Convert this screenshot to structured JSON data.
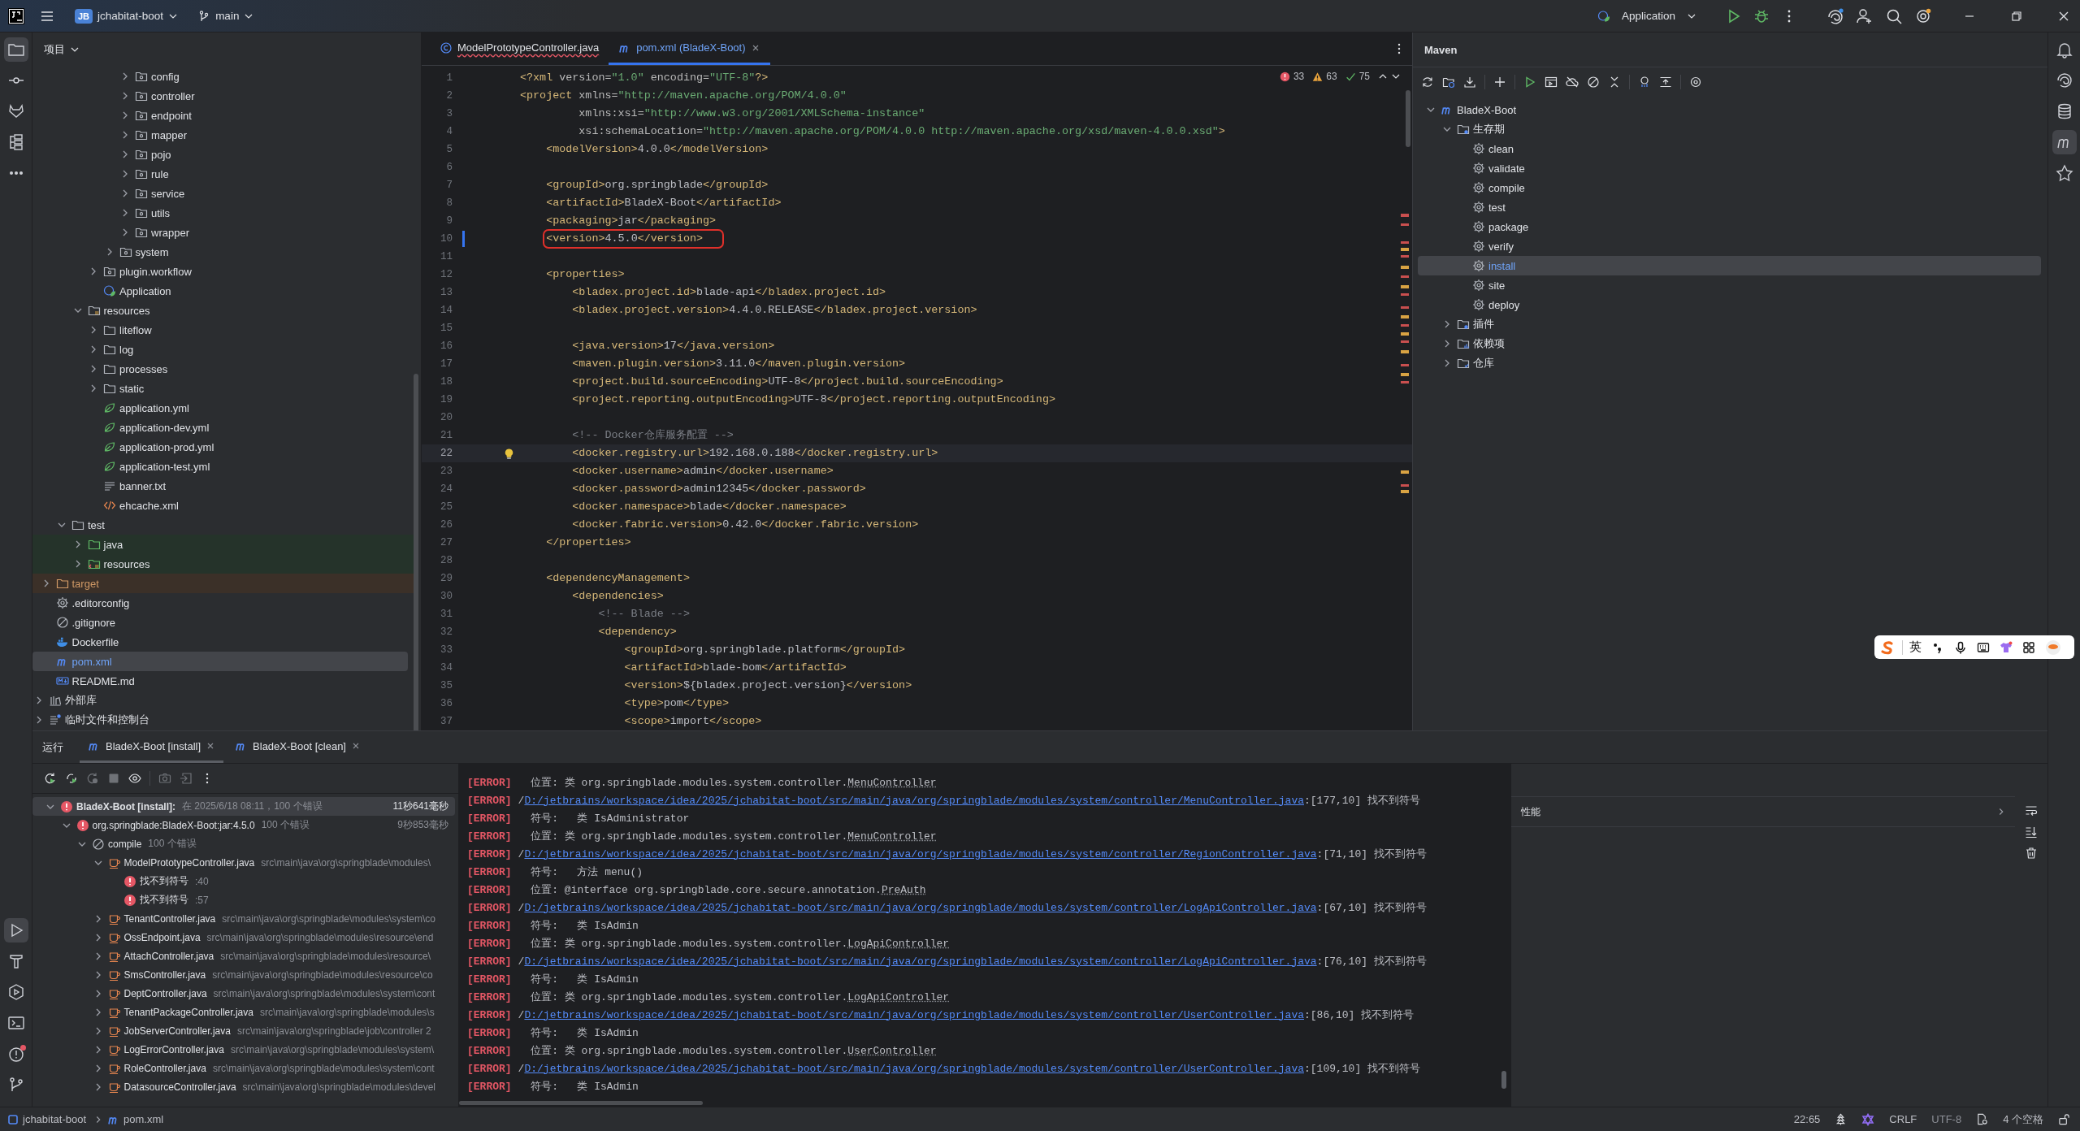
{
  "title_bar": {
    "project_badge": "JB",
    "project": "jchabitat-boot",
    "branch": "main",
    "run_config": "Application"
  },
  "left_toolbar": {
    "top": [
      {
        "kind": "project",
        "selected": true
      },
      {
        "kind": "commit",
        "selected": false
      },
      {
        "kind": "cat",
        "selected": false
      },
      {
        "kind": "structure",
        "selected": false
      },
      {
        "kind": "more",
        "selected": false
      }
    ],
    "bottom": [
      {
        "kind": "run",
        "selected": true
      },
      {
        "kind": "build",
        "selected": false
      },
      {
        "kind": "services",
        "selected": false
      },
      {
        "kind": "terminal",
        "selected": false
      },
      {
        "kind": "problems",
        "selected": false,
        "badge": true
      },
      {
        "kind": "git",
        "selected": false
      }
    ]
  },
  "right_toolbar": [
    {
      "kind": "notifications",
      "selected": false
    },
    {
      "kind": "spiral",
      "selected": false
    },
    {
      "kind": "database",
      "selected": false
    },
    {
      "kind": "maven",
      "selected": true
    },
    {
      "kind": "star",
      "selected": false
    }
  ],
  "project_panel": {
    "title": "项目",
    "tree": [
      {
        "children": [
          {
            "children": [
              {
                "children": [
                  {
                    "children": [
                      {
                        "children": [
                          {
                            "children": [
                              {
                                "label": "config",
                                "kind": "package",
                                "expanded": false,
                                "selected": false
                              },
                              {
                                "label": "controller",
                                "kind": "package",
                                "expanded": false,
                                "selected": false
                              },
                              {
                                "label": "endpoint",
                                "kind": "package",
                                "expanded": false,
                                "selected": false
                              },
                              {
                                "label": "mapper",
                                "kind": "package",
                                "expanded": false,
                                "selected": false
                              },
                              {
                                "label": "pojo",
                                "kind": "package",
                                "expanded": false,
                                "selected": false
                              },
                              {
                                "label": "rule",
                                "kind": "package",
                                "expanded": false,
                                "selected": false
                              },
                              {
                                "label": "service",
                                "kind": "package",
                                "expanded": false,
                                "selected": false
                              },
                              {
                                "label": "utils",
                                "kind": "package",
                                "expanded": false,
                                "selected": false
                              },
                              {
                                "label": "wrapper",
                                "kind": "package",
                                "expanded": false,
                                "selected": false
                              }
                            ]
                          },
                          {
                            "label": "system",
                            "kind": "package",
                            "expanded": false,
                            "selected": false
                          }
                        ]
                      },
                      {
                        "label": "plugin.workflow",
                        "kind": "package",
                        "expanded": false,
                        "selected": false
                      },
                      {
                        "label": "Application",
                        "kind": "spring-app",
                        "selected": false
                      }
                    ]
                  },
                  {
                    "label": "resources",
                    "kind": "resources",
                    "expanded": true,
                    "selected": false,
                    "children": [
                      {
                        "label": "liteflow",
                        "kind": "folder",
                        "expanded": false,
                        "selected": false
                      },
                      {
                        "label": "log",
                        "kind": "folder",
                        "expanded": false,
                        "selected": false
                      },
                      {
                        "label": "processes",
                        "kind": "folder",
                        "expanded": false,
                        "selected": false
                      },
                      {
                        "label": "static",
                        "kind": "folder",
                        "expanded": false,
                        "selected": false
                      },
                      {
                        "label": "application.yml",
                        "kind": "yml",
                        "selected": false
                      },
                      {
                        "label": "application-dev.yml",
                        "kind": "yml",
                        "selected": false
                      },
                      {
                        "label": "application-prod.yml",
                        "kind": "yml",
                        "selected": false
                      },
                      {
                        "label": "application-test.yml",
                        "kind": "yml",
                        "selected": false
                      },
                      {
                        "label": "banner.txt",
                        "kind": "text",
                        "selected": false
                      },
                      {
                        "label": "ehcache.xml",
                        "kind": "xml",
                        "selected": false
                      }
                    ]
                  }
                ]
              },
              {
                "label": "test",
                "kind": "folder",
                "expanded": true,
                "selected": false,
                "children": [
                  {
                    "label": "java",
                    "kind": "test-sources",
                    "expanded": false,
                    "selected": false
                  },
                  {
                    "label": "resources",
                    "kind": "test-resources",
                    "expanded": false,
                    "selected": false
                  }
                ]
              }
            ]
          },
          {
            "label": "target",
            "kind": "excluded",
            "expanded": false,
            "selected": false
          },
          {
            "label": ".editorconfig",
            "kind": "config",
            "selected": false
          },
          {
            "label": ".gitignore",
            "kind": "ignore",
            "selected": false
          },
          {
            "label": "Dockerfile",
            "kind": "docker",
            "selected": false
          },
          {
            "label": "pom.xml",
            "kind": "maven",
            "selected": true
          },
          {
            "label": "README.md",
            "kind": "markdown",
            "selected": false
          }
        ]
      },
      {
        "label": "外部库",
        "kind": "library",
        "expanded": false,
        "selected": false
      },
      {
        "label": "临时文件和控制台",
        "kind": "scratch",
        "expanded": false,
        "selected": false
      }
    ]
  },
  "editor": {
    "tabs": [
      {
        "label": "ModelPrototypeController.java",
        "kind": "class",
        "selected": false,
        "has_errors": true
      },
      {
        "label": "pom.xml (BladeX-Boot)",
        "kind": "maven",
        "selected": true,
        "has_errors": false
      }
    ],
    "inspections": {
      "errors": "33",
      "warnings": "63",
      "checks": "75"
    },
    "lines": [
      {
        "number": "1",
        "text": "<?xml version=\"1.0\" encoding=\"UTF-8\"?>"
      },
      {
        "number": "2",
        "text": "<project xmlns=\"http://maven.apache.org/POM/4.0.0\""
      },
      {
        "number": "3",
        "text": "         xmlns:xsi=\"http://www.w3.org/2001/XMLSchema-instance\""
      },
      {
        "number": "4",
        "text": "         xsi:schemaLocation=\"http://maven.apache.org/POM/4.0.0 http://maven.apache.org/xsd/maven-4.0.0.xsd\">"
      },
      {
        "number": "5",
        "text": "    <modelVersion>4.0.0</modelVersion>"
      },
      {
        "number": "6"
      },
      {
        "number": "7",
        "text": "    <groupId>org.springblade</groupId>"
      },
      {
        "number": "8",
        "text": "    <artifactId>BladeX-Boot</artifactId>"
      },
      {
        "number": "9",
        "text": "    <packaging>jar</packaging>"
      },
      {
        "number": "10",
        "text": "    <version>4.5.0</version>",
        "circled": true,
        "modified": true
      },
      {
        "number": "11"
      },
      {
        "number": "12",
        "text": "    <properties>"
      },
      {
        "number": "13",
        "text": "        <bladex.project.id>blade-api</bladex.project.id>"
      },
      {
        "number": "14",
        "text": "        <bladex.project.version>4.4.0.RELEASE</bladex.project.version>"
      },
      {
        "number": "15"
      },
      {
        "number": "16",
        "text": "        <java.version>17</java.version>"
      },
      {
        "number": "17",
        "text": "        <maven.plugin.version>3.11.0</maven.plugin.version>"
      },
      {
        "number": "18",
        "text": "        <project.build.sourceEncoding>UTF-8</project.build.sourceEncoding>"
      },
      {
        "number": "19",
        "text": "        <project.reporting.outputEncoding>UTF-8</project.reporting.outputEncoding>"
      },
      {
        "number": "20"
      },
      {
        "number": "21",
        "text": "        <!-- Docker仓库服务配置 -->"
      },
      {
        "number": "22",
        "text": "        <docker.registry.url>192.168.0.188</docker.registry.url>",
        "current": true,
        "intention": true
      },
      {
        "number": "23",
        "text": "        <docker.username>admin</docker.username>"
      },
      {
        "number": "24",
        "text": "        <docker.password>admin12345</docker.password>"
      },
      {
        "number": "25",
        "text": "        <docker.namespace>blade</docker.namespace>"
      },
      {
        "number": "26",
        "text": "        <docker.fabric.version>0.42.0</docker.fabric.version>"
      },
      {
        "number": "27",
        "text": "    </properties>"
      },
      {
        "number": "28"
      },
      {
        "number": "29",
        "text": "    <dependencyManagement>"
      },
      {
        "number": "30",
        "text": "        <dependencies>"
      },
      {
        "number": "31",
        "text": "            <!-- Blade -->"
      },
      {
        "number": "32",
        "text": "            <dependency>"
      },
      {
        "number": "33",
        "text": "                <groupId>org.springblade.platform</groupId>"
      },
      {
        "number": "34",
        "text": "                <artifactId>blade-bom</artifactId>"
      },
      {
        "number": "35",
        "text": "                <version>${bladex.project.version}</version>"
      },
      {
        "number": "36",
        "text": "                <type>pom</type>"
      },
      {
        "number": "37",
        "text": "                <scope>import</scope>"
      }
    ]
  },
  "maven_panel": {
    "title": "Maven",
    "tree": [
      {
        "label": "BladeX-Boot",
        "kind": "maven",
        "expanded": true,
        "selected": false,
        "children": [
          {
            "label": "生存期",
            "kind": "lifecycle",
            "expanded": true,
            "selected": false,
            "children": [
              {
                "label": "clean",
                "kind": "goal",
                "selected": false
              },
              {
                "label": "validate",
                "kind": "goal",
                "selected": false
              },
              {
                "label": "compile",
                "kind": "goal",
                "selected": false
              },
              {
                "label": "test",
                "kind": "goal",
                "selected": false
              },
              {
                "label": "package",
                "kind": "goal",
                "selected": false
              },
              {
                "label": "verify",
                "kind": "goal",
                "selected": false
              },
              {
                "label": "install",
                "kind": "goal",
                "selected": true
              },
              {
                "label": "site",
                "kind": "goal",
                "selected": false
              },
              {
                "label": "deploy",
                "kind": "goal",
                "selected": false
              }
            ]
          },
          {
            "label": "插件",
            "kind": "lifecycle",
            "expanded": false,
            "selected": false
          },
          {
            "label": "依赖项",
            "kind": "dependencies",
            "expanded": false,
            "selected": false
          },
          {
            "label": "仓库",
            "kind": "repositories",
            "expanded": false,
            "selected": false
          }
        ]
      }
    ]
  },
  "run_panel": {
    "title": "运行",
    "tabs": [
      {
        "label": "BladeX-Boot [install]",
        "selected": true
      },
      {
        "label": "BladeX-Boot [clean]",
        "selected": false
      }
    ],
    "tree": [
      {
        "label": "BladeX-Boot [install]:",
        "detail": "在 2025/6/18 08:11，100 个错误",
        "duration": "11秒641毫秒",
        "kind": "error",
        "expanded": true,
        "selected": true,
        "children": [
          {
            "label": "org.springblade:BladeX-Boot:jar:4.5.0",
            "detail": "100 个错误",
            "duration": "9秒853毫秒",
            "kind": "error",
            "expanded": true,
            "selected": false,
            "children": [
              {
                "label": "compile",
                "detail": "100 个错误",
                "kind": "skipped",
                "expanded": true,
                "selected": false,
                "children": [
                  {
                    "label": "ModelPrototypeController.java",
                    "detail": "src\\main\\java\\org\\springblade\\modules\\",
                    "kind": "java-file",
                    "expanded": true,
                    "selected": false,
                    "children": [
                      {
                        "label": "找不到符号",
                        "detail": ":40",
                        "kind": "error",
                        "selected": false
                      },
                      {
                        "label": "找不到符号",
                        "detail": ":57",
                        "kind": "error",
                        "selected": false
                      }
                    ]
                  },
                  {
                    "label": "TenantController.java",
                    "detail": "src\\main\\java\\org\\springblade\\modules\\system\\co",
                    "kind": "java-file",
                    "expanded": false,
                    "selected": false
                  },
                  {
                    "label": "OssEndpoint.java",
                    "detail": "src\\main\\java\\org\\springblade\\modules\\resource\\end",
                    "kind": "java-file",
                    "expanded": false,
                    "selected": false
                  },
                  {
                    "label": "AttachController.java",
                    "detail": "src\\main\\java\\org\\springblade\\modules\\resource\\",
                    "kind": "java-file",
                    "expanded": false,
                    "selected": false
                  },
                  {
                    "label": "SmsController.java",
                    "detail": "src\\main\\java\\org\\springblade\\modules\\resource\\co",
                    "kind": "java-file",
                    "expanded": false,
                    "selected": false
                  },
                  {
                    "label": "DeptController.java",
                    "detail": "src\\main\\java\\org\\springblade\\modules\\system\\cont",
                    "kind": "java-file",
                    "expanded": false,
                    "selected": false
                  },
                  {
                    "label": "TenantPackageController.java",
                    "detail": "src\\main\\java\\org\\springblade\\modules\\s",
                    "kind": "java-file",
                    "expanded": false,
                    "selected": false
                  },
                  {
                    "label": "JobServerController.java",
                    "detail": "src\\main\\java\\org\\springblade\\job\\controller 2",
                    "kind": "java-file",
                    "expanded": false,
                    "selected": false
                  },
                  {
                    "label": "LogErrorController.java",
                    "detail": "src\\main\\java\\org\\springblade\\modules\\system\\",
                    "kind": "java-file",
                    "expanded": false,
                    "selected": false
                  },
                  {
                    "label": "RoleController.java",
                    "detail": "src\\main\\java\\org\\springblade\\modules\\system\\cont",
                    "kind": "java-file",
                    "expanded": false,
                    "selected": false
                  },
                  {
                    "label": "DatasourceController.java",
                    "detail": "src\\main\\java\\org\\springblade\\modules\\devel",
                    "kind": "java-file",
                    "expanded": false,
                    "selected": false
                  }
                ]
              }
            ]
          }
        ]
      }
    ],
    "console": [
      {
        "kind": "detail",
        "tag": "[ERROR]",
        "text": "  位置: 类 org.springblade.modules.system.controller.",
        "ref": "MenuController"
      },
      {
        "kind": "path",
        "tag": "[ERROR]",
        "lead": "/",
        "link": "D:/jetbrains/workspace/idea/2025/jchabitat-boot/src/main/java/org/springblade/modules/system/controller/MenuController.java",
        "tail": ":[177,10] 找不到符号"
      },
      {
        "kind": "detail",
        "tag": "[ERROR]",
        "text": "  符号:   类 IsAdministrator"
      },
      {
        "kind": "detail",
        "tag": "[ERROR]",
        "text": "  位置: 类 org.springblade.modules.system.controller.",
        "ref": "MenuController"
      },
      {
        "kind": "path",
        "tag": "[ERROR]",
        "lead": "/",
        "link": "D:/jetbrains/workspace/idea/2025/jchabitat-boot/src/main/java/org/springblade/modules/system/controller/RegionController.java",
        "tail": ":[71,10] 找不到符号"
      },
      {
        "kind": "detail",
        "tag": "[ERROR]",
        "text": "  符号:   方法 menu()"
      },
      {
        "kind": "detail",
        "tag": "[ERROR]",
        "text": "  位置: @interface org.springblade.core.secure.annotation.",
        "ref": "PreAuth"
      },
      {
        "kind": "path",
        "tag": "[ERROR]",
        "lead": "/",
        "link": "D:/jetbrains/workspace/idea/2025/jchabitat-boot/src/main/java/org/springblade/modules/system/controller/LogApiController.java",
        "tail": ":[67,10] 找不到符号"
      },
      {
        "kind": "detail",
        "tag": "[ERROR]",
        "text": "  符号:   类 IsAdmin"
      },
      {
        "kind": "detail",
        "tag": "[ERROR]",
        "text": "  位置: 类 org.springblade.modules.system.controller.",
        "ref": "LogApiController"
      },
      {
        "kind": "path",
        "tag": "[ERROR]",
        "lead": "/",
        "link": "D:/jetbrains/workspace/idea/2025/jchabitat-boot/src/main/java/org/springblade/modules/system/controller/LogApiController.java",
        "tail": ":[76,10] 找不到符号"
      },
      {
        "kind": "detail",
        "tag": "[ERROR]",
        "text": "  符号:   类 IsAdmin"
      },
      {
        "kind": "detail",
        "tag": "[ERROR]",
        "text": "  位置: 类 org.springblade.modules.system.controller.",
        "ref": "LogApiController"
      },
      {
        "kind": "path",
        "tag": "[ERROR]",
        "lead": "/",
        "link": "D:/jetbrains/workspace/idea/2025/jchabitat-boot/src/main/java/org/springblade/modules/system/controller/UserController.java",
        "tail": ":[86,10] 找不到符号"
      },
      {
        "kind": "detail",
        "tag": "[ERROR]",
        "text": "  符号:   类 IsAdmin"
      },
      {
        "kind": "detail",
        "tag": "[ERROR]",
        "text": "  位置: 类 org.springblade.modules.system.controller.",
        "ref": "UserController"
      },
      {
        "kind": "path",
        "tag": "[ERROR]",
        "lead": "/",
        "link": "D:/jetbrains/workspace/idea/2025/jchabitat-boot/src/main/java/org/springblade/modules/system/controller/UserController.java",
        "tail": ":[109,10] 找不到符号"
      },
      {
        "kind": "detail",
        "tag": "[ERROR]",
        "text": "  符号:   类 IsAdmin"
      }
    ],
    "side_panel": {
      "title": "性能"
    }
  },
  "ime_toolbar": {
    "mode": "英"
  },
  "status_bar": {
    "breadcrumbs": [
      {
        "label": "jchabitat-boot",
        "kind": "module"
      },
      {
        "label": "pom.xml",
        "kind": "maven"
      }
    ],
    "position": "22:65",
    "line_separator": "CRLF",
    "encoding": "UTF-8",
    "indent": "4 个空格"
  }
}
